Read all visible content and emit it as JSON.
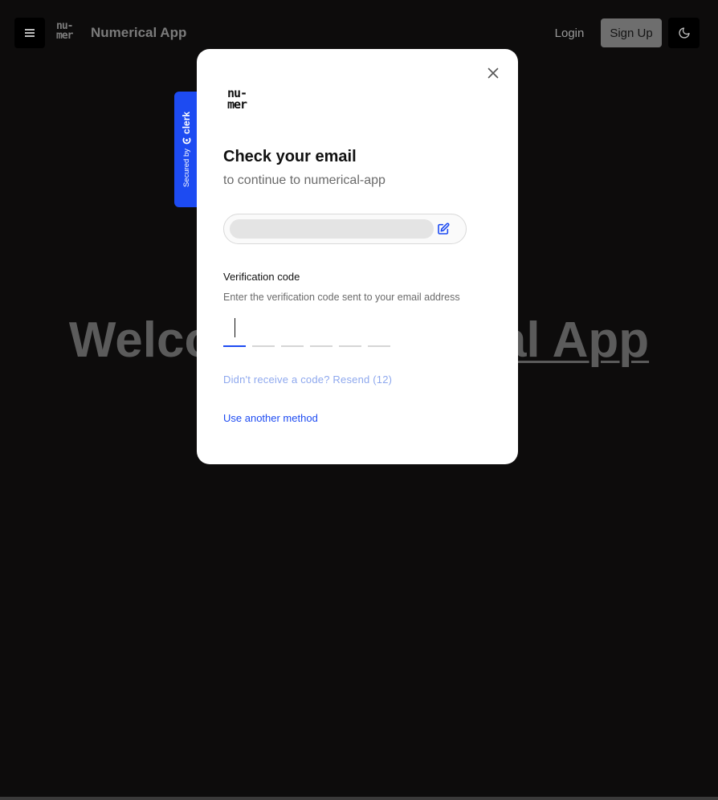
{
  "header": {
    "menu_icon": "hamburger-icon",
    "logo_lines": [
      "nu-",
      "mer"
    ],
    "app_title": "Numerical App",
    "login_label": "Login",
    "signup_label": "Sign Up",
    "theme_icon": "moon-icon"
  },
  "hero": {
    "text_left": "Welcom",
    "text_right": "cal App"
  },
  "clerk_badge": {
    "secured_label": "Secured by",
    "brand_label": "clerk"
  },
  "modal": {
    "logo_lines": [
      "nu-",
      "mer"
    ],
    "title": "Check your email",
    "subtitle": "to continue to numerical-app",
    "email_value": "",
    "edit_icon": "edit-icon",
    "close_icon": "close-icon",
    "verification_label": "Verification code",
    "verification_hint": "Enter the verification code sent to your email address",
    "otp_cells": [
      "",
      "",
      "",
      "",
      "",
      ""
    ],
    "resend_text": "Didn't receive a code? Resend (12)",
    "another_method": "Use another method"
  },
  "colors": {
    "background": "#0d0c0c",
    "accent": "#1d4bf2",
    "modal_bg": "#ffffff"
  }
}
